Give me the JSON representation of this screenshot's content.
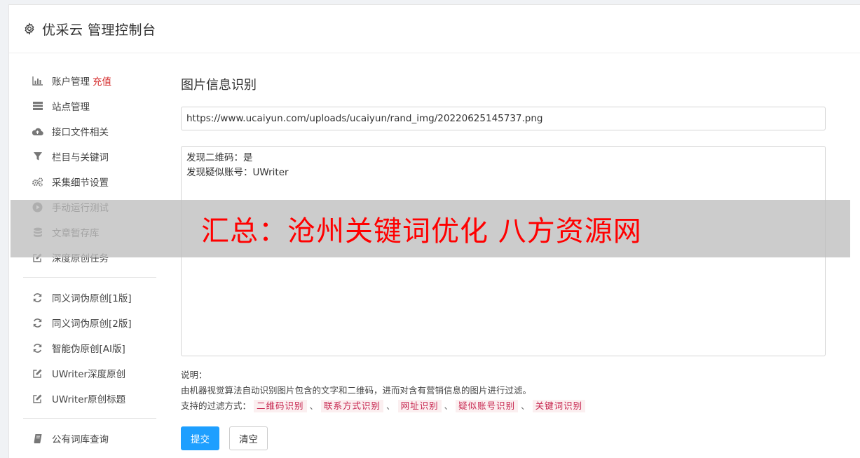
{
  "header": {
    "title": "优采云 管理控制台",
    "icon": "gear-icon"
  },
  "sidebar": {
    "groups": [
      [
        {
          "label": "账户管理",
          "tag": "充值",
          "icon": "bar-chart-icon"
        },
        {
          "label": "站点管理",
          "icon": "server-icon"
        },
        {
          "label": "接口文件相关",
          "icon": "cloud-upload-icon"
        },
        {
          "label": "栏目与关键词",
          "icon": "filter-icon"
        },
        {
          "label": "采集细节设置",
          "icon": "gears-icon"
        },
        {
          "label": "手动运行测试",
          "icon": "play-circle-icon"
        },
        {
          "label": "文章暂存库",
          "icon": "database-icon"
        },
        {
          "label": "深度原创任务",
          "icon": "edit-icon"
        }
      ],
      [
        {
          "label": "同义词伪原创[1版]",
          "icon": "refresh-icon"
        },
        {
          "label": "同义词伪原创[2版]",
          "icon": "refresh-icon"
        },
        {
          "label": "智能伪原创[AI版]",
          "icon": "refresh-icon"
        },
        {
          "label": "UWriter深度原创",
          "icon": "edit-icon"
        },
        {
          "label": "UWriter原创标题",
          "icon": "edit-icon"
        }
      ],
      [
        {
          "label": "公有词库查询",
          "icon": "book-icon"
        }
      ]
    ]
  },
  "main": {
    "title": "图片信息识别",
    "url_value": "https://www.ucaiyun.com/uploads/ucaiyun/rand_img/20220625145737.png",
    "result_value": "发现二维码：是\n发现疑似账号：UWriter",
    "notes_title": "说明：",
    "notes_desc": "由机器视觉算法自动识别图片包含的文字和二维码，进而对含有营销信息的图片进行过滤。",
    "filters_label": "支持的过滤方式：",
    "filters": [
      "二维码识别",
      "联系方式识别",
      "网址识别",
      "疑似账号识别",
      "关键词识别"
    ],
    "filter_separator": "、",
    "submit_label": "提交",
    "clear_label": "清空"
  },
  "overlay": {
    "text": "汇总：沧州关键词优化 八方资源网"
  },
  "colors": {
    "primary": "#1e9fff",
    "tag_red": "#d42a2a",
    "chip_text": "#c7254e",
    "overlay_text": "#ff0000"
  }
}
